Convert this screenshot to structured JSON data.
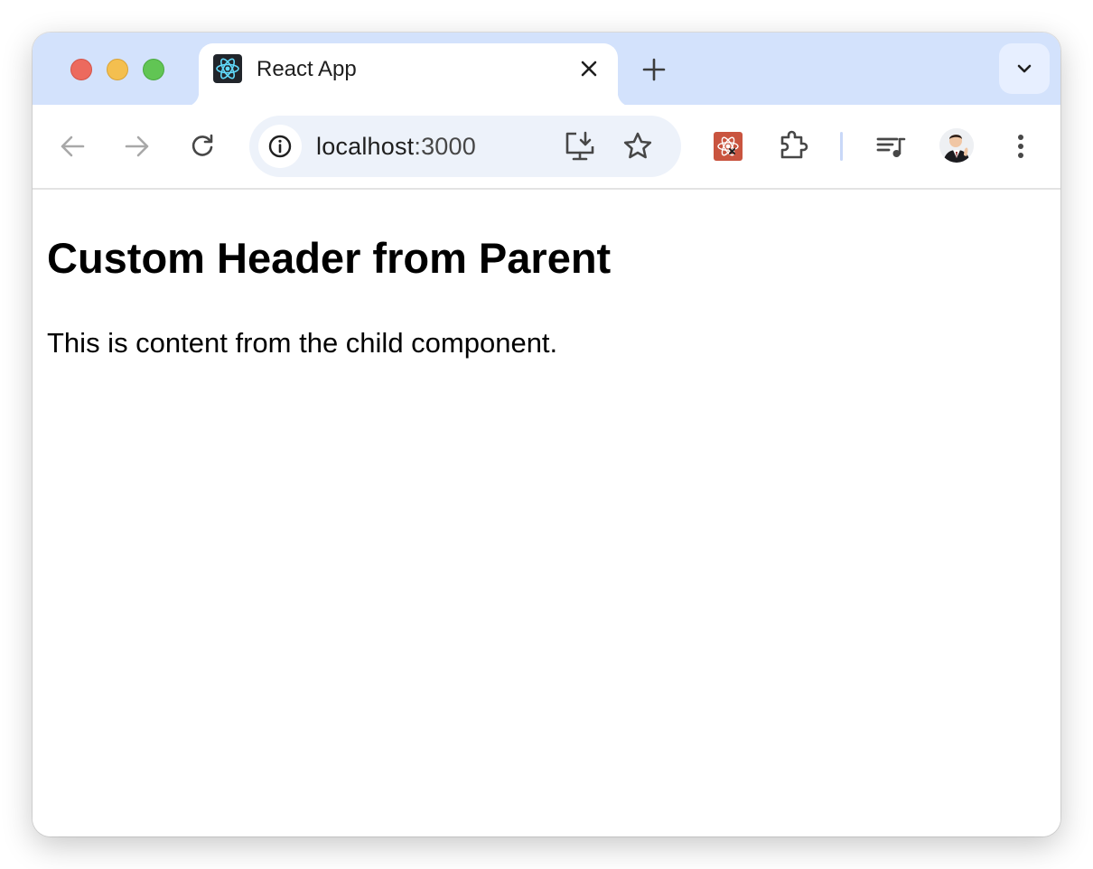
{
  "tab": {
    "title": "React App",
    "favicon_icon": "react-logo-icon",
    "close_icon": "close-icon"
  },
  "tabstrip": {
    "new_tab_icon": "plus-icon",
    "tab_search_icon": "chevron-down-icon"
  },
  "toolbar": {
    "back_icon": "arrow-left-icon",
    "forward_icon": "arrow-right-icon",
    "reload_icon": "reload-icon",
    "site_info_icon": "info-icon",
    "url_host": "localhost",
    "url_port": ":3000",
    "install_icon": "install-app-icon",
    "bookmark_icon": "star-icon",
    "extensions": [
      "react-devtools-icon",
      "puzzle-icon"
    ],
    "media_icon": "media-queue-icon",
    "profile": "avatar",
    "menu_icon": "kebab-menu-icon"
  },
  "page": {
    "heading": "Custom Header from Parent",
    "body": "This is content from the child component."
  },
  "colors": {
    "tabstrip": "#d3e2fc",
    "omnibox": "#edf2fa",
    "react_blue": "#61dafb",
    "devtools_red": "#c9543f"
  }
}
